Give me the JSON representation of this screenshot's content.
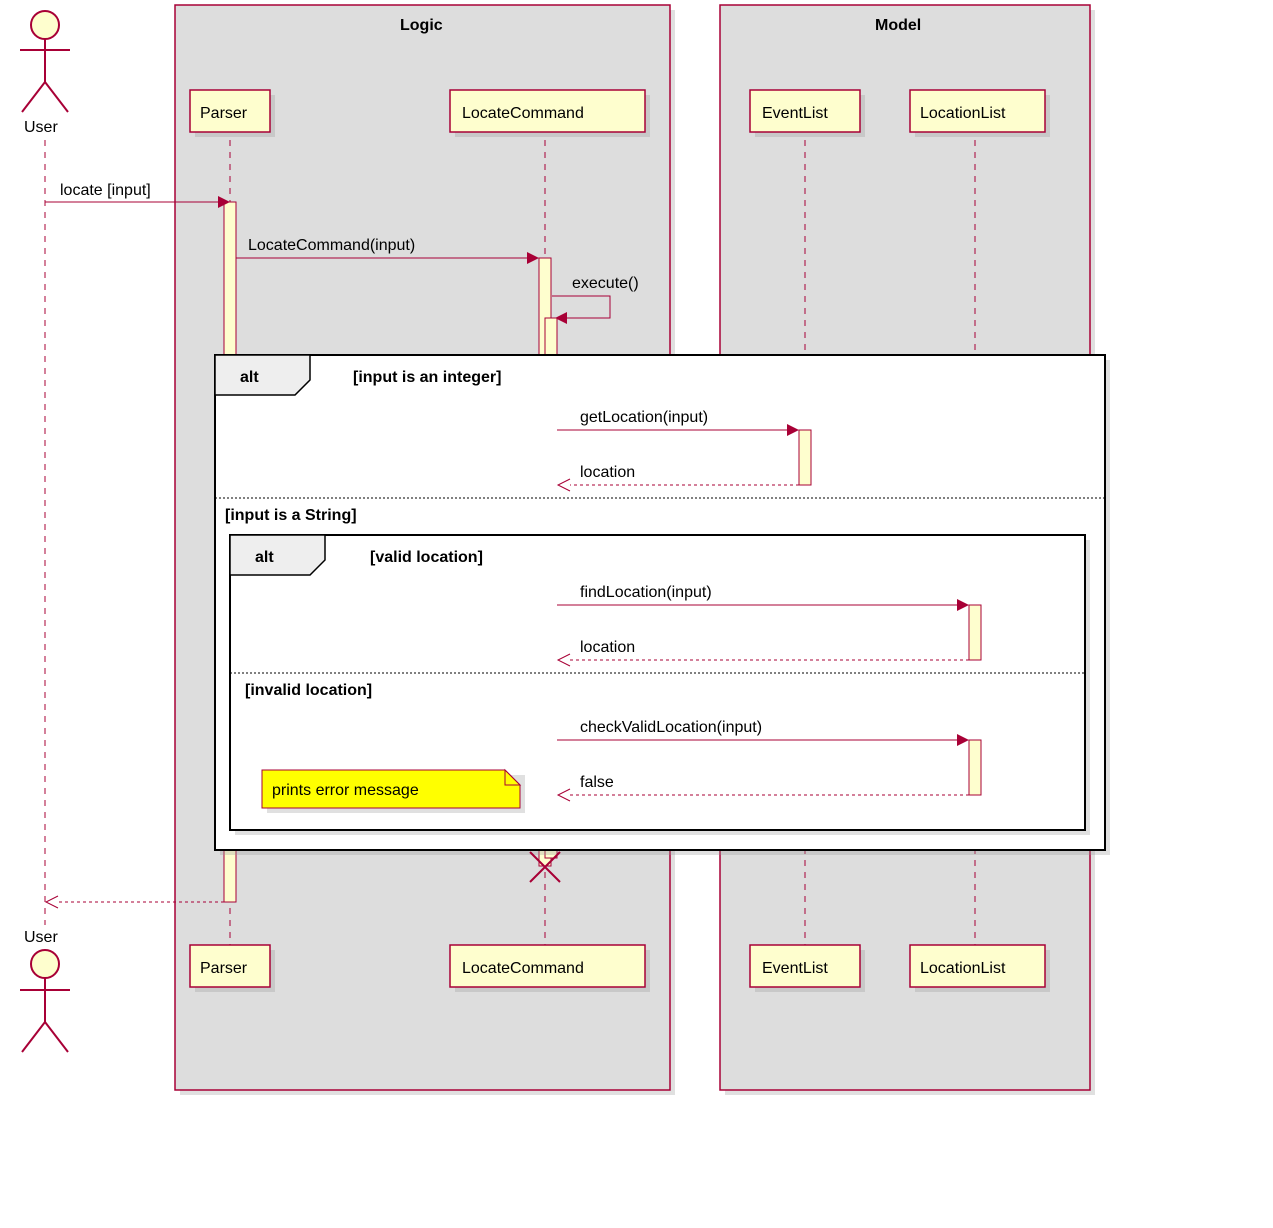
{
  "actor": {
    "name": "User"
  },
  "boxes": {
    "logic": {
      "title": "Logic"
    },
    "model": {
      "title": "Model"
    }
  },
  "participants": {
    "parser": "Parser",
    "locateCommand": "LocateCommand",
    "eventList": "EventList",
    "locationList": "LocationList"
  },
  "messages": {
    "m1": "locate [input]",
    "m2": "LocateCommand(input)",
    "m3": "execute()",
    "m4": "getLocation(input)",
    "m5": "location",
    "m6": "findLocation(input)",
    "m7": "location",
    "m8": "checkValidLocation(input)",
    "m9": "false"
  },
  "frames": {
    "outerAlt": {
      "label": "alt",
      "guard1": "[input is an integer]",
      "guard2": "[input is a String]"
    },
    "innerAlt": {
      "label": "alt",
      "guard1": "[valid location]",
      "guard2": "[invalid location]"
    }
  },
  "note": {
    "text": "prints error message"
  }
}
